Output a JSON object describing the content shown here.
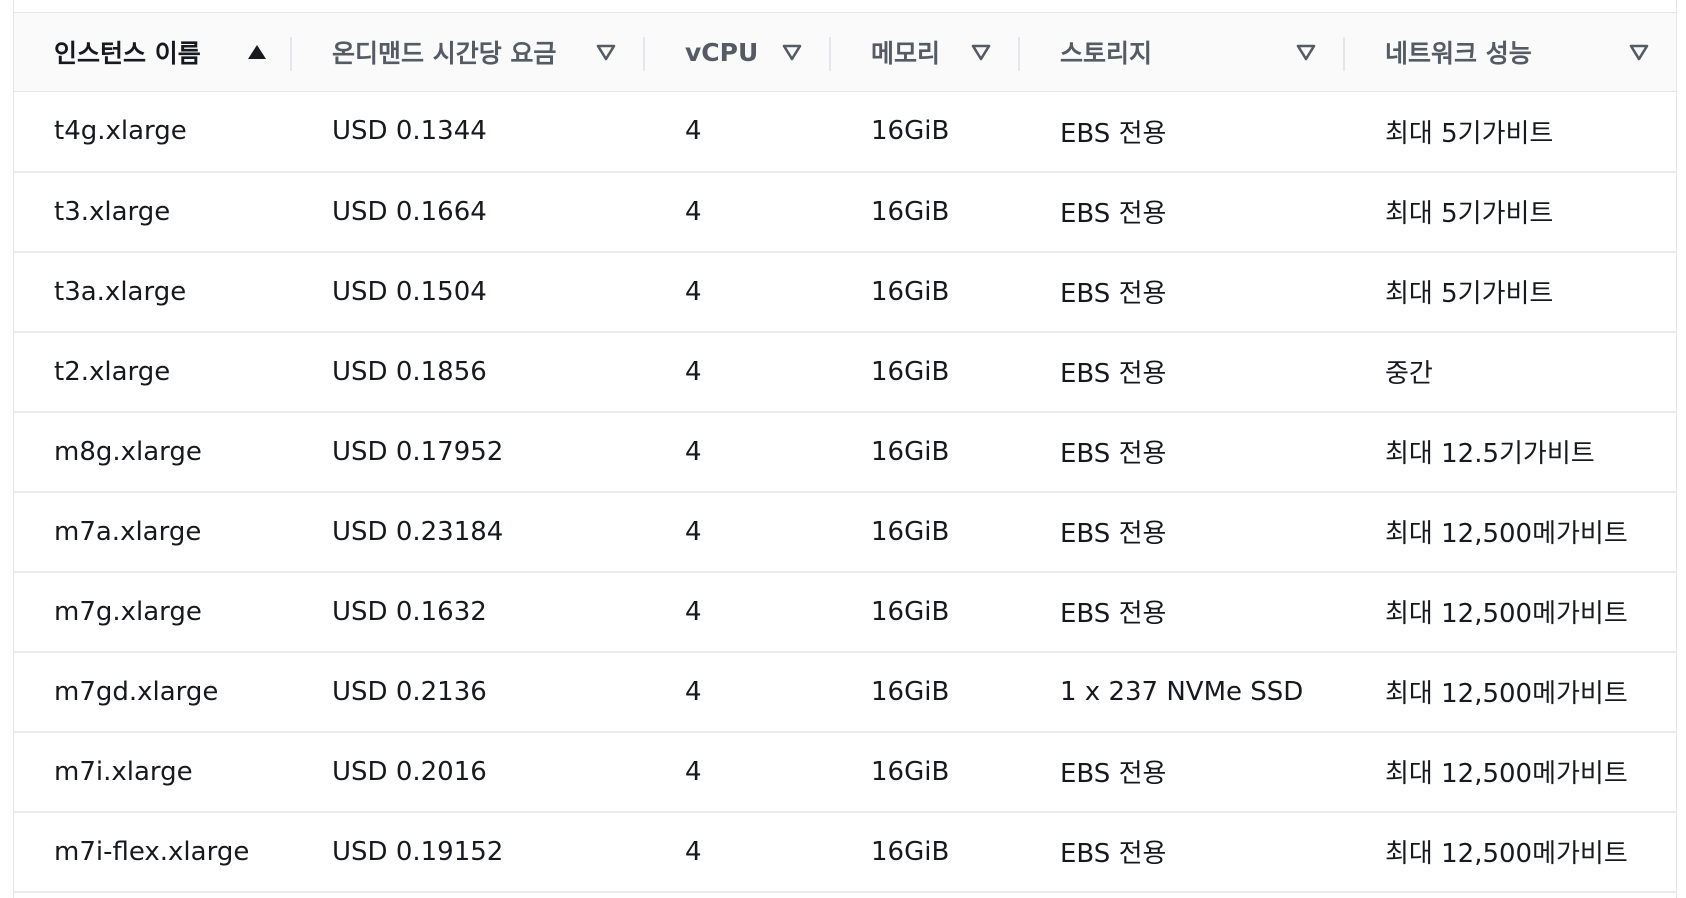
{
  "columns": [
    {
      "label": "인스턴스 이름",
      "sort": "asc-active"
    },
    {
      "label": "온디맨드 시간당 요금",
      "sort": "desc"
    },
    {
      "label": "vCPU",
      "sort": "desc"
    },
    {
      "label": "메모리",
      "sort": "desc"
    },
    {
      "label": "스토리지",
      "sort": "desc"
    },
    {
      "label": "네트워크 성능",
      "sort": "desc"
    }
  ],
  "rows": [
    [
      "t4g.xlarge",
      "USD 0.1344",
      "4",
      "16GiB",
      "EBS 전용",
      "최대 5기가비트"
    ],
    [
      "t3.xlarge",
      "USD 0.1664",
      "4",
      "16GiB",
      "EBS 전용",
      "최대 5기가비트"
    ],
    [
      "t3a.xlarge",
      "USD 0.1504",
      "4",
      "16GiB",
      "EBS 전용",
      "최대 5기가비트"
    ],
    [
      "t2.xlarge",
      "USD 0.1856",
      "4",
      "16GiB",
      "EBS 전용",
      "중간"
    ],
    [
      "m8g.xlarge",
      "USD 0.17952",
      "4",
      "16GiB",
      "EBS 전용",
      "최대 12.5기가비트"
    ],
    [
      "m7a.xlarge",
      "USD 0.23184",
      "4",
      "16GiB",
      "EBS 전용",
      "최대 12,500메가비트"
    ],
    [
      "m7g.xlarge",
      "USD 0.1632",
      "4",
      "16GiB",
      "EBS 전용",
      "최대 12,500메가비트"
    ],
    [
      "m7gd.xlarge",
      "USD 0.2136",
      "4",
      "16GiB",
      "1 x 237 NVMe SSD",
      "최대 12,500메가비트"
    ],
    [
      "m7i.xlarge",
      "USD 0.2016",
      "4",
      "16GiB",
      "EBS 전용",
      "최대 12,500메가비트"
    ],
    [
      "m7i-flex.xlarge",
      "USD 0.19152",
      "4",
      "16GiB",
      "EBS 전용",
      "최대 12,500메가비트"
    ]
  ],
  "colors": {
    "header_bg": "#fafafa",
    "text": "#16191f",
    "header_text": "#545b64",
    "border": "#e9ebed"
  }
}
